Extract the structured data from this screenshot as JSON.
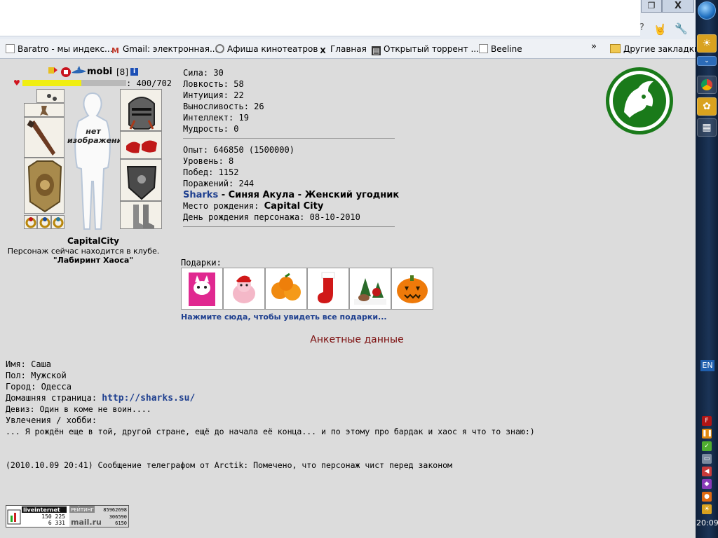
{
  "browser": {
    "window_restore_glyph": "❐",
    "window_close_glyph": "X",
    "star_glyph": "?",
    "bookmarks": [
      {
        "label": "Baratro - мы индекс...",
        "icon": "page-icon"
      },
      {
        "label": "Gmail: электронная...",
        "icon": "gmail-icon"
      },
      {
        "label": "Афиша кинотеатров",
        "icon": "film-reel-icon"
      },
      {
        "label": "Главная",
        "icon": "x-icon"
      },
      {
        "label": "Открытый торрент ...",
        "icon": "torrent-icon"
      },
      {
        "label": "Beeline",
        "icon": "page-icon"
      }
    ],
    "more_glyph": "»",
    "other_bookmarks": "Другие закладки"
  },
  "taskbar": {
    "lang": "EN",
    "clock": "20:09"
  },
  "character": {
    "name": "mobi",
    "level": "[8]",
    "info_glyph": "i",
    "hp_text": ": 400/702",
    "hp_current": 400,
    "hp_max": 702,
    "no_image": "нет изображения",
    "city": "CapitalCity",
    "location": "Персонаж сейчас находится в клубе.",
    "club": "\"Лабиринт Хаоса\""
  },
  "stats": [
    {
      "label": "Сила: ",
      "value": "30"
    },
    {
      "label": "Ловкость: ",
      "value": "58"
    },
    {
      "label": "Интуиция: ",
      "value": "22"
    },
    {
      "label": "Выносливость: ",
      "value": "26"
    },
    {
      "label": "Интеллект: ",
      "value": "19"
    },
    {
      "label": "Мудрость: ",
      "value": "0"
    }
  ],
  "progress": [
    {
      "label": "Опыт: ",
      "value": "646850 (1500000)"
    },
    {
      "label": "Уровень: ",
      "value": "8"
    },
    {
      "label": "Побед: ",
      "value": "1152"
    },
    {
      "label": "Поражений: ",
      "value": "244"
    }
  ],
  "clan": {
    "name": "Sharks",
    "title": " - Синяя Акула - Женский угодник"
  },
  "birth": {
    "place_label": "Место рождения: ",
    "place_value": "Capital City",
    "day_label": "День рождения персонажа: ",
    "day_value": "08-10-2010"
  },
  "gifts": {
    "label": "Подарки:",
    "items": [
      "pink-cat-gift",
      "bunny-gift",
      "tangerines-gift",
      "christmas-stocking-gift",
      "snowy-deer-gift",
      "pumpkin-gift"
    ],
    "link": "Нажмите сюда, чтобы увидеть все подарки..."
  },
  "profile": {
    "title": "Анкетные данные",
    "name_label": "Имя: ",
    "name_value": "Саша",
    "gender_label": "Пол: ",
    "gender_value": "Мужской",
    "city_label": "Город: ",
    "city_value": "Одесса",
    "homepage_label": "Домашняя страница: ",
    "homepage_value": "http://sharks.su/",
    "motto": "Девиз: Один в коме не воин....",
    "hobby_label": "Увлечения / хобби:",
    "hobby_text": "... Я рождён еще в той, другой стране, ещё до начала её конца... и по этому про бардак и хаос я что то знаю:)",
    "telegraph": "(2010.10.09 20:41) Сообщение телеграфом от Arctik: Помечено, что персонаж чист перед законом"
  },
  "counter": {
    "brand1": "liveinternet",
    "num1a": "150 225",
    "num1b": "6 331",
    "rating_label": "РЕЙТИНГ",
    "rating_num": "85962698",
    "brand2": "mail.ru",
    "num2a": "306590",
    "num2b": "6150"
  },
  "colors": {
    "page_bg": "#dcdcdc",
    "link": "#1e3f8f",
    "section_title": "#7b0c0c",
    "hp_fill": "#f0ee12",
    "clan_green": "#1a7a1a"
  }
}
